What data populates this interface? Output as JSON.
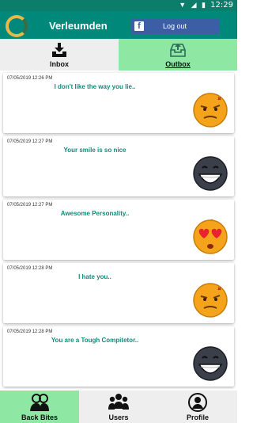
{
  "status_bar": {
    "time": "12:29",
    "icons": "▼ ◢ ▮"
  },
  "app": {
    "title": "Verleumden",
    "logout_label": "Log out",
    "fb_letter": "f"
  },
  "tabs": [
    {
      "label": "Inbox",
      "active": false
    },
    {
      "label": "Outbox",
      "active": true
    }
  ],
  "messages": [
    {
      "timestamp": "07/05/2019 12:26 PM",
      "text": "I don't like the way you lie..",
      "emoji": "annoyed-face-icon"
    },
    {
      "timestamp": "07/05/2019 12:27 PM",
      "text": "Your smile is so nice",
      "emoji": "grinning-dark-face-icon"
    },
    {
      "timestamp": "07/05/2019 12:27 PM",
      "text": "Awesome Personality..",
      "emoji": "heart-eyes-face-icon"
    },
    {
      "timestamp": "07/05/2019 12:28 PM",
      "text": "I hate you..",
      "emoji": "annoyed-face-icon"
    },
    {
      "timestamp": "07/05/2019 12:28 PM",
      "text": "You are a Tough Compitetor..",
      "emoji": "grinning-dark-face-icon"
    }
  ],
  "bottom_nav": [
    {
      "label": "Back Bites",
      "icon": "people-icon",
      "active": true
    },
    {
      "label": "Users",
      "icon": "group-icon",
      "active": false
    },
    {
      "label": "Profile",
      "icon": "user-icon",
      "active": false
    }
  ],
  "colors": {
    "primary": "#00897b",
    "accent": "#8ee7a3",
    "message_text": "#0f8c7a",
    "facebook": "#3b5ea4"
  }
}
